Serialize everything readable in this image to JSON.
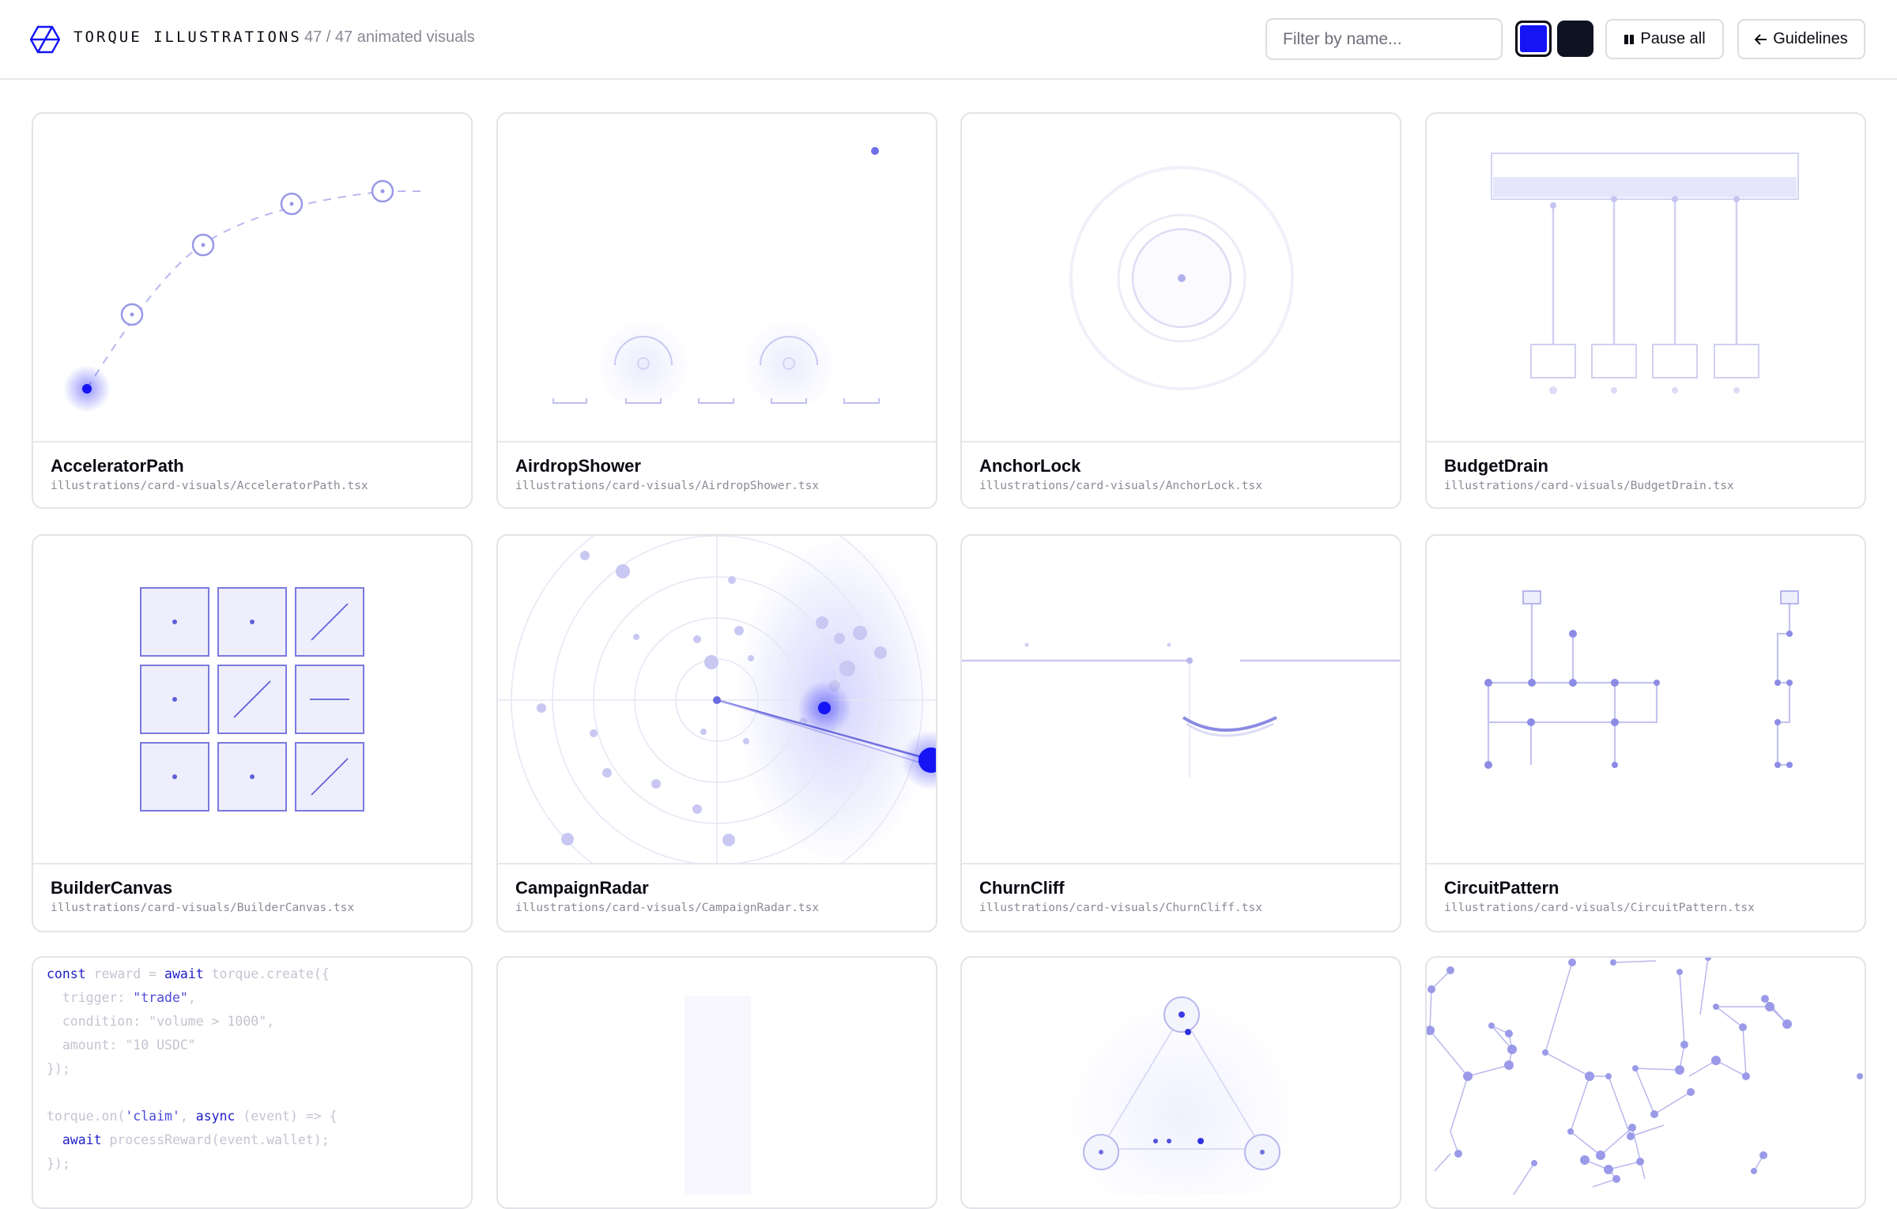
{
  "header": {
    "brand": "TORQUE ILLUSTRATIONS",
    "count": "47 / 47 animated visuals",
    "filter_placeholder": "Filter by name...",
    "pause_label": "Pause all",
    "guidelines_label": "Guidelines",
    "swatches": [
      "#1414f5",
      "#0f1220"
    ]
  },
  "cards": [
    {
      "name": "AcceleratorPath",
      "path": "illustrations/card-visuals/AcceleratorPath.tsx"
    },
    {
      "name": "AirdropShower",
      "path": "illustrations/card-visuals/AirdropShower.tsx"
    },
    {
      "name": "AnchorLock",
      "path": "illustrations/card-visuals/AnchorLock.tsx"
    },
    {
      "name": "BudgetDrain",
      "path": "illustrations/card-visuals/BudgetDrain.tsx"
    },
    {
      "name": "BuilderCanvas",
      "path": "illustrations/card-visuals/BuilderCanvas.tsx"
    },
    {
      "name": "CampaignRadar",
      "path": "illustrations/card-visuals/CampaignRadar.tsx"
    },
    {
      "name": "ChurnCliff",
      "path": "illustrations/card-visuals/ChurnCliff.tsx"
    },
    {
      "name": "CircuitPattern",
      "path": "illustrations/card-visuals/CircuitPattern.tsx"
    }
  ],
  "code_card": {
    "lines": [
      "const reward = await torque.create({",
      "  trigger: \"trade\",",
      "  condition: \"volume > 1000\",",
      "  amount: \"10 USDC\"",
      "});",
      "",
      "torque.on('claim', async (event) => {",
      "  await processReward(event.wallet);",
      "});"
    ]
  },
  "accent_color": "#1414f5"
}
